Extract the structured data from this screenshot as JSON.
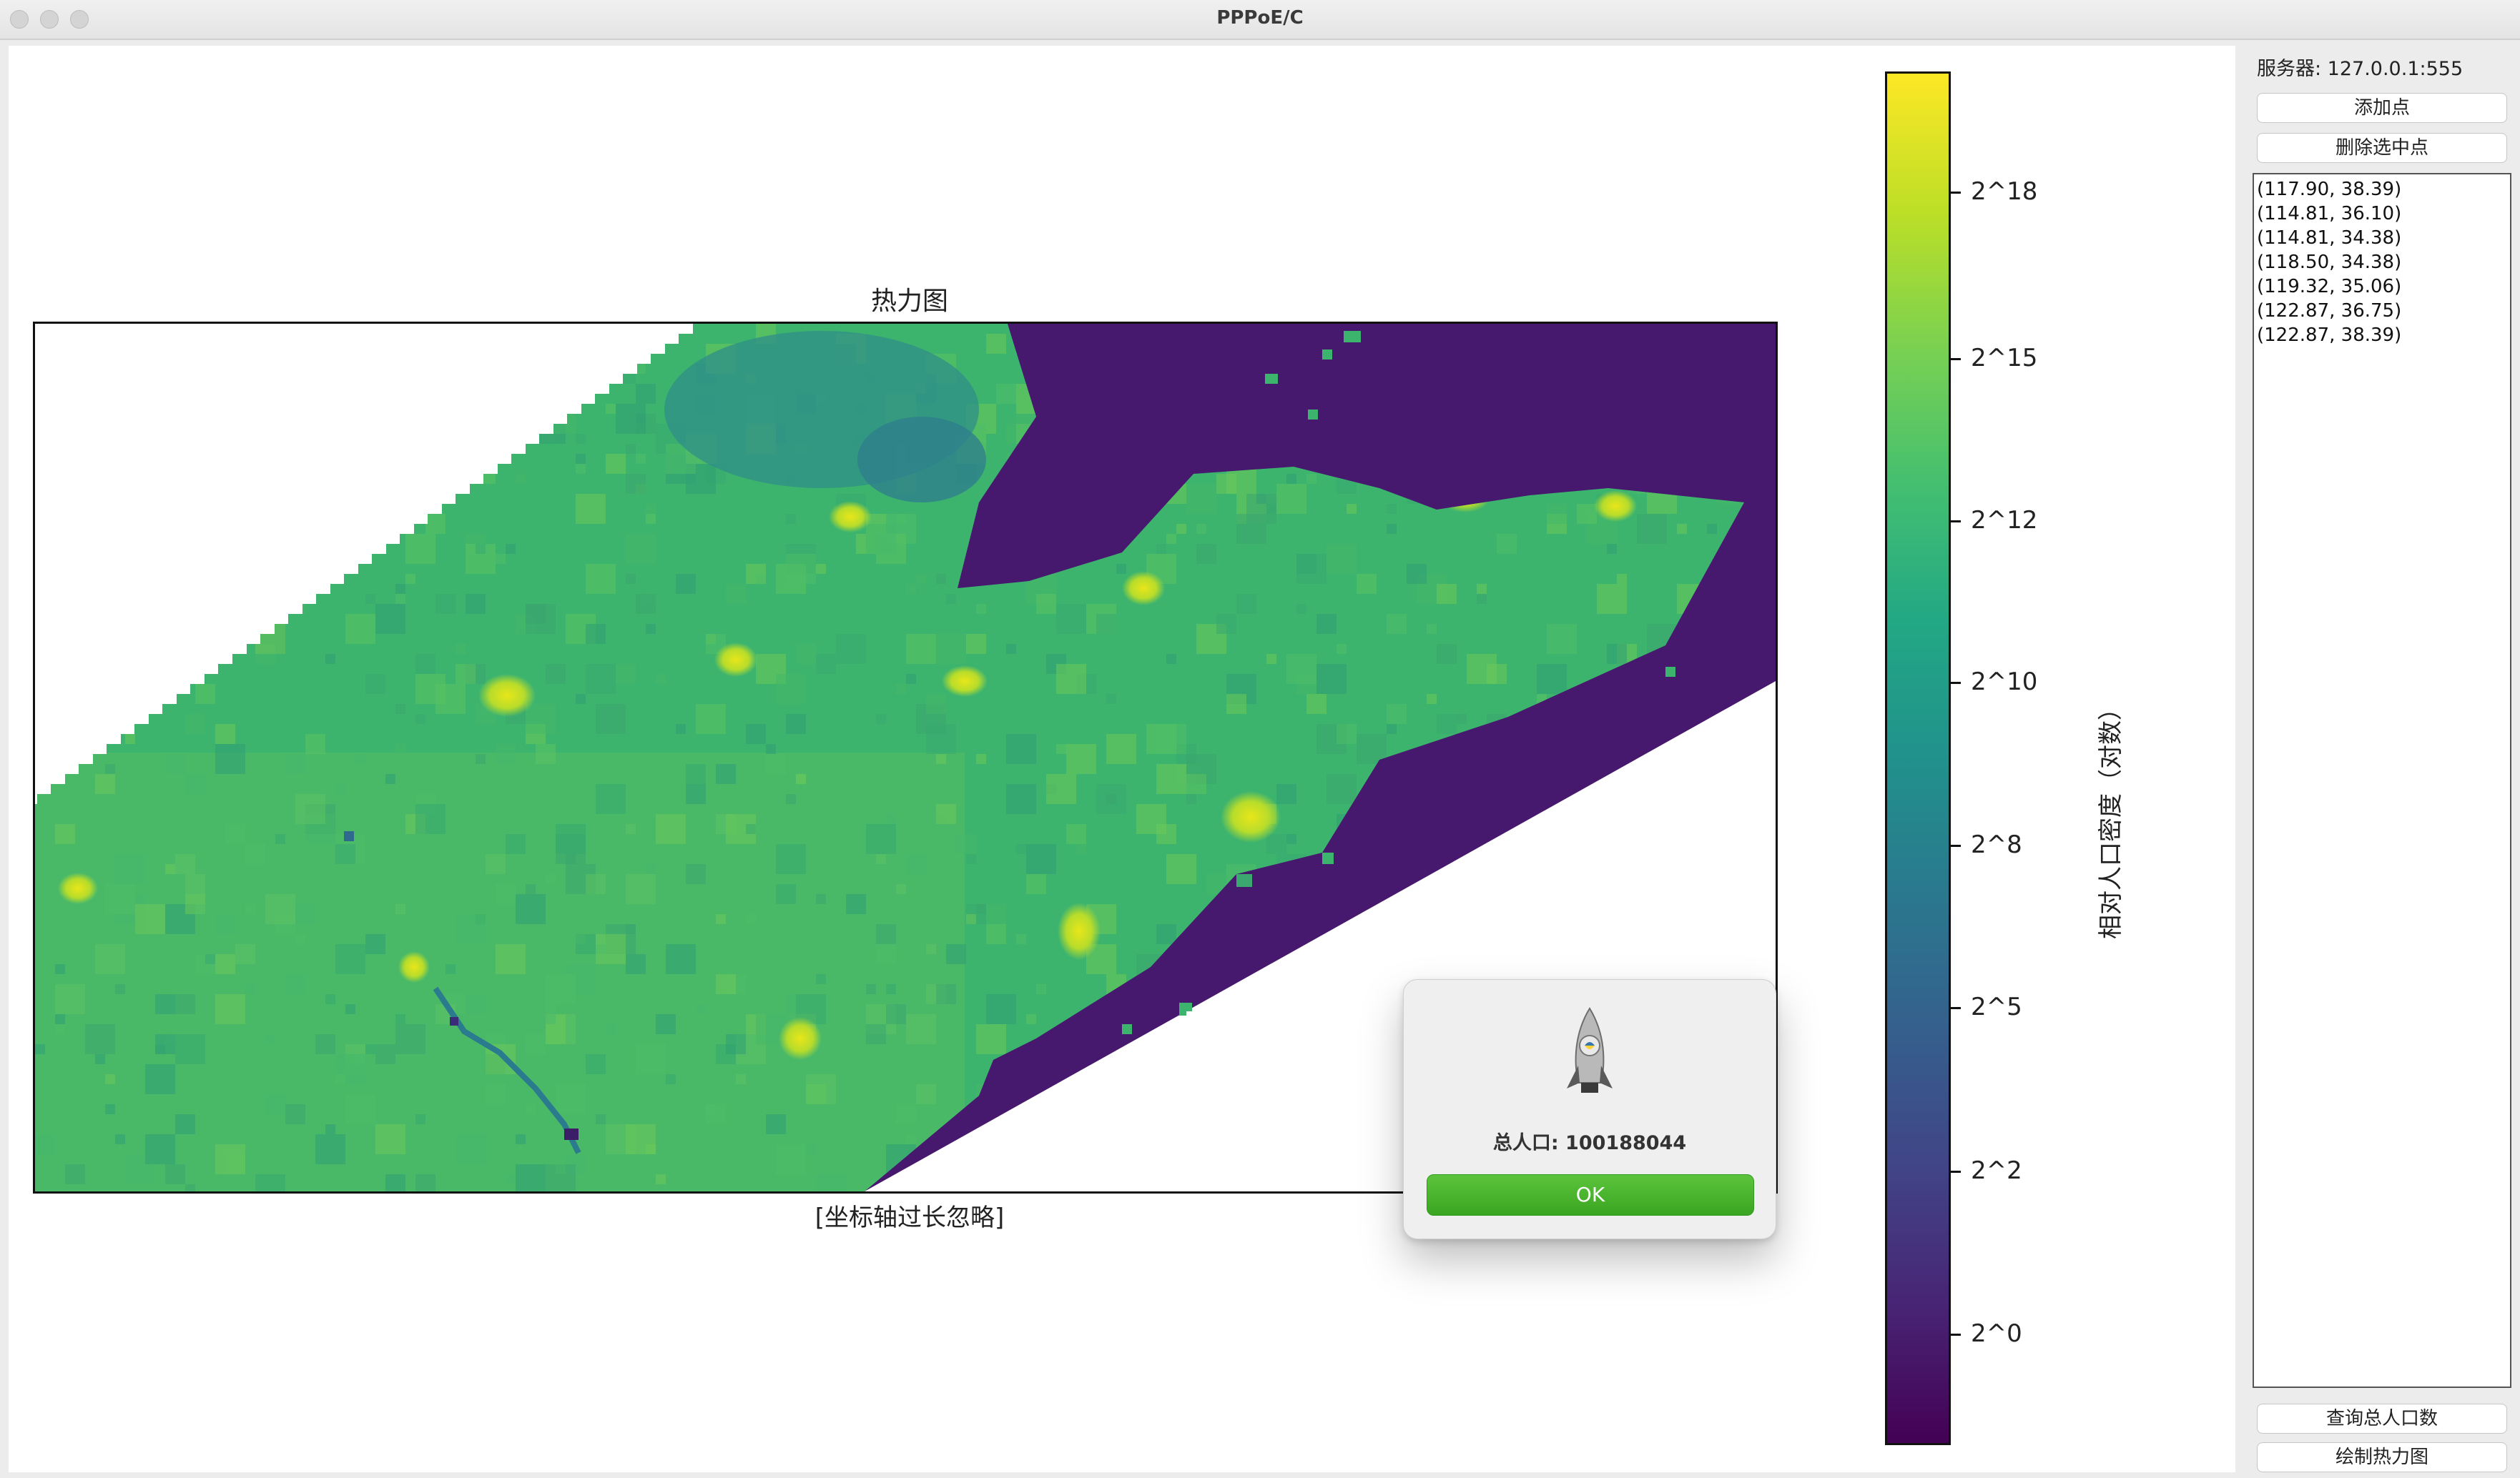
{
  "window": {
    "title": "PPPoE/C"
  },
  "chart": {
    "title": "热力图",
    "axis_note": "[坐标轴过长忽略]",
    "colorbar": {
      "label": "相对人口密度（对数）",
      "ticks": [
        "2^0",
        "2^2",
        "2^5",
        "2^8",
        "2^10",
        "2^12",
        "2^15",
        "2^18"
      ]
    }
  },
  "chart_data": {
    "type": "heatmap",
    "title": "热力图",
    "xlabel": "[坐标轴过长忽略]",
    "colorbar_label": "相对人口密度（对数）",
    "colorbar_scale": "log2",
    "colorbar_ticks": [
      "2^0",
      "2^2",
      "2^5",
      "2^8",
      "2^10",
      "2^12",
      "2^15",
      "2^18"
    ],
    "colormap": "viridis"
  },
  "side": {
    "server": "服务器: 127.0.0.1:555",
    "add_point": "添加点",
    "delete_selected": "删除选中点",
    "points": [
      "(117.90, 38.39)",
      "(114.81, 36.10)",
      "(114.81, 34.38)",
      "(118.50, 34.38)",
      "(119.32, 35.06)",
      "(122.87, 36.75)",
      "(122.87, 38.39)"
    ],
    "query_population": "查询总人口数",
    "draw_heatmap": "绘制热力图"
  },
  "dialog": {
    "message": "总人口: 100188044",
    "ok": "OK"
  },
  "colors": {
    "sea": "#46196e",
    "land_base": "#3db46d",
    "hot": "#e5e419",
    "ok_button": "#3aa521"
  }
}
